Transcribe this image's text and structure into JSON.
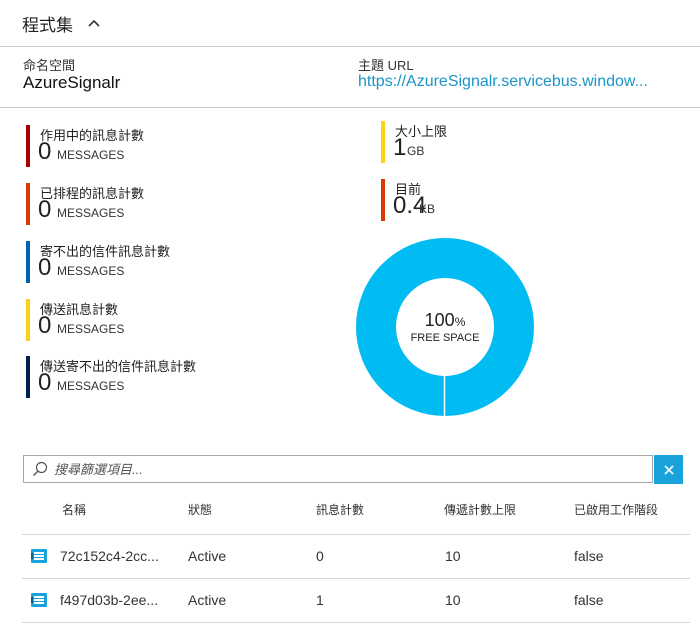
{
  "section": {
    "title": "程式集"
  },
  "info": {
    "namespace_label": "命名空間",
    "namespace_value": "AzureSignalr",
    "topic_url_label": "主題 URL",
    "topic_url_value": "https://AzureSignalr.servicebus.window..."
  },
  "metrics": [
    {
      "label": "作用中的訊息計數",
      "value": "0",
      "unit": "MESSAGES",
      "color": "#a80000"
    },
    {
      "label": "已排程的訊息計數",
      "value": "0",
      "unit": "MESSAGES",
      "color": "#d83b01"
    },
    {
      "label": "寄不出的信件訊息計數",
      "value": "0",
      "unit": "MESSAGES",
      "color": "#0063b1"
    },
    {
      "label": "傳送訊息計數",
      "value": "0",
      "unit": "MESSAGES",
      "color": "#fcd116"
    },
    {
      "label": "傳送寄不出的信件訊息計數",
      "value": "0",
      "unit": "MESSAGES",
      "color": "#002050"
    }
  ],
  "size": {
    "max_label": "大小上限",
    "max_value": "1",
    "max_unit": "GB",
    "max_color": "#fcd116",
    "current_label": "目前",
    "current_value": "0.4",
    "current_unit": "KB",
    "current_color": "#d83b01"
  },
  "donut": {
    "percent_text": "100",
    "percent_sign": "%",
    "caption": "FREE SPACE",
    "free_fraction": 1.0,
    "color": "#00bcf2"
  },
  "search": {
    "placeholder": "搜尋篩選項目..."
  },
  "table": {
    "headers": {
      "name": "名稱",
      "status": "狀態",
      "message_count": "訊息計數",
      "max_delivery": "傳遞計數上限",
      "sessions": "已啟用工作階段"
    },
    "rows": [
      {
        "name": "72c152c4-2cc...",
        "status": "Active",
        "message_count": "0",
        "max_delivery": "10",
        "sessions": "false"
      },
      {
        "name": "f497d03b-2ee...",
        "status": "Active",
        "message_count": "1",
        "max_delivery": "10",
        "sessions": "false"
      }
    ]
  }
}
